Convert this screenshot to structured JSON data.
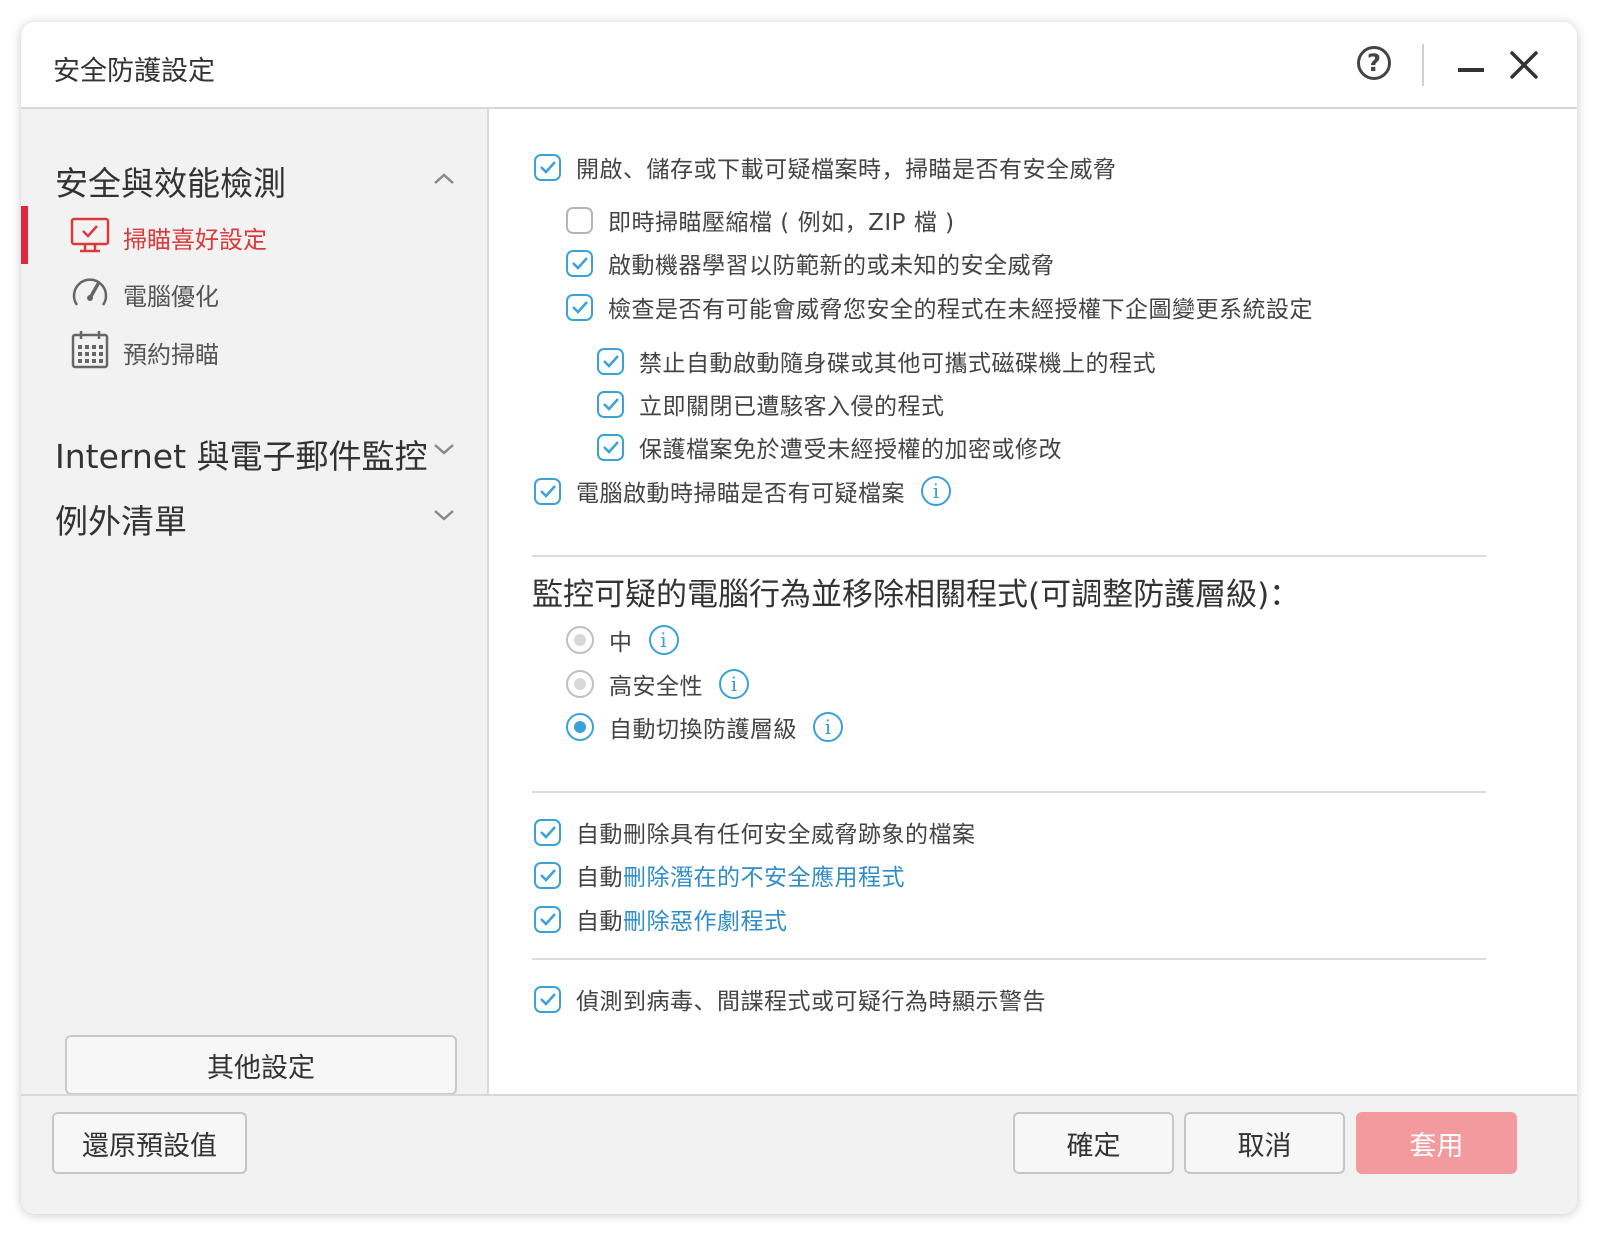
{
  "window": {
    "title": "安全防護設定"
  },
  "sidebar": {
    "sections": [
      {
        "label": "安全與效能檢測",
        "expanded": true
      },
      {
        "label": "Internet 與電子郵件監控",
        "expanded": false
      },
      {
        "label": "例外清單",
        "expanded": false
      }
    ],
    "items": [
      {
        "label": "掃瞄喜好設定",
        "icon": "monitor-check-icon",
        "active": true
      },
      {
        "label": "電腦優化",
        "icon": "speedometer-icon",
        "active": false
      },
      {
        "label": "預約掃瞄",
        "icon": "calendar-icon",
        "active": false
      }
    ],
    "other_button": "其他設定"
  },
  "content": {
    "options": [
      {
        "label": "開啟、儲存或下載可疑檔案時，掃瞄是否有安全威脅",
        "checked": true
      },
      {
        "label": "即時掃瞄壓縮檔 ( 例如，ZIP 檔 )",
        "checked": false
      },
      {
        "label": "啟動機器學習以防範新的或未知的安全威脅",
        "checked": true
      },
      {
        "label": "檢查是否有可能會威脅您安全的程式在未經授權下企圖變更系統設定",
        "checked": true
      },
      {
        "label": "禁止自動啟動隨身碟或其他可攜式磁碟機上的程式",
        "checked": true
      },
      {
        "label": "立即關閉已遭駭客入侵的程式",
        "checked": true
      },
      {
        "label": "保護檔案免於遭受未經授權的加密或修改",
        "checked": true
      },
      {
        "label": "電腦啟動時掃瞄是否有可疑檔案",
        "checked": true
      }
    ],
    "monitor_heading": "監控可疑的電腦行為並移除相關程式(可調整防護層級)：",
    "radios": [
      {
        "label": "中",
        "selected": false
      },
      {
        "label": "高安全性",
        "selected": false
      },
      {
        "label": "自動切換防護層級",
        "selected": true
      }
    ],
    "auto_delete": [
      {
        "prefix": "自動刪除具有任何安全威脅跡象的檔案",
        "link": "",
        "checked": true
      },
      {
        "prefix": "自動",
        "link": "刪除潛在的不安全應用程式",
        "checked": true
      },
      {
        "prefix": "自動",
        "link": "刪除惡作劇程式",
        "checked": true
      }
    ],
    "warning_option": {
      "label": "偵測到病毒、間諜程式或可疑行為時顯示警告",
      "checked": true
    }
  },
  "footer": {
    "restore": "還原預設值",
    "ok": "確定",
    "cancel": "取消",
    "apply": "套用"
  },
  "colors": {
    "accent_blue": "#3aa2d9",
    "active_red": "#e0263a",
    "apply_pink": "#f39a9e"
  }
}
